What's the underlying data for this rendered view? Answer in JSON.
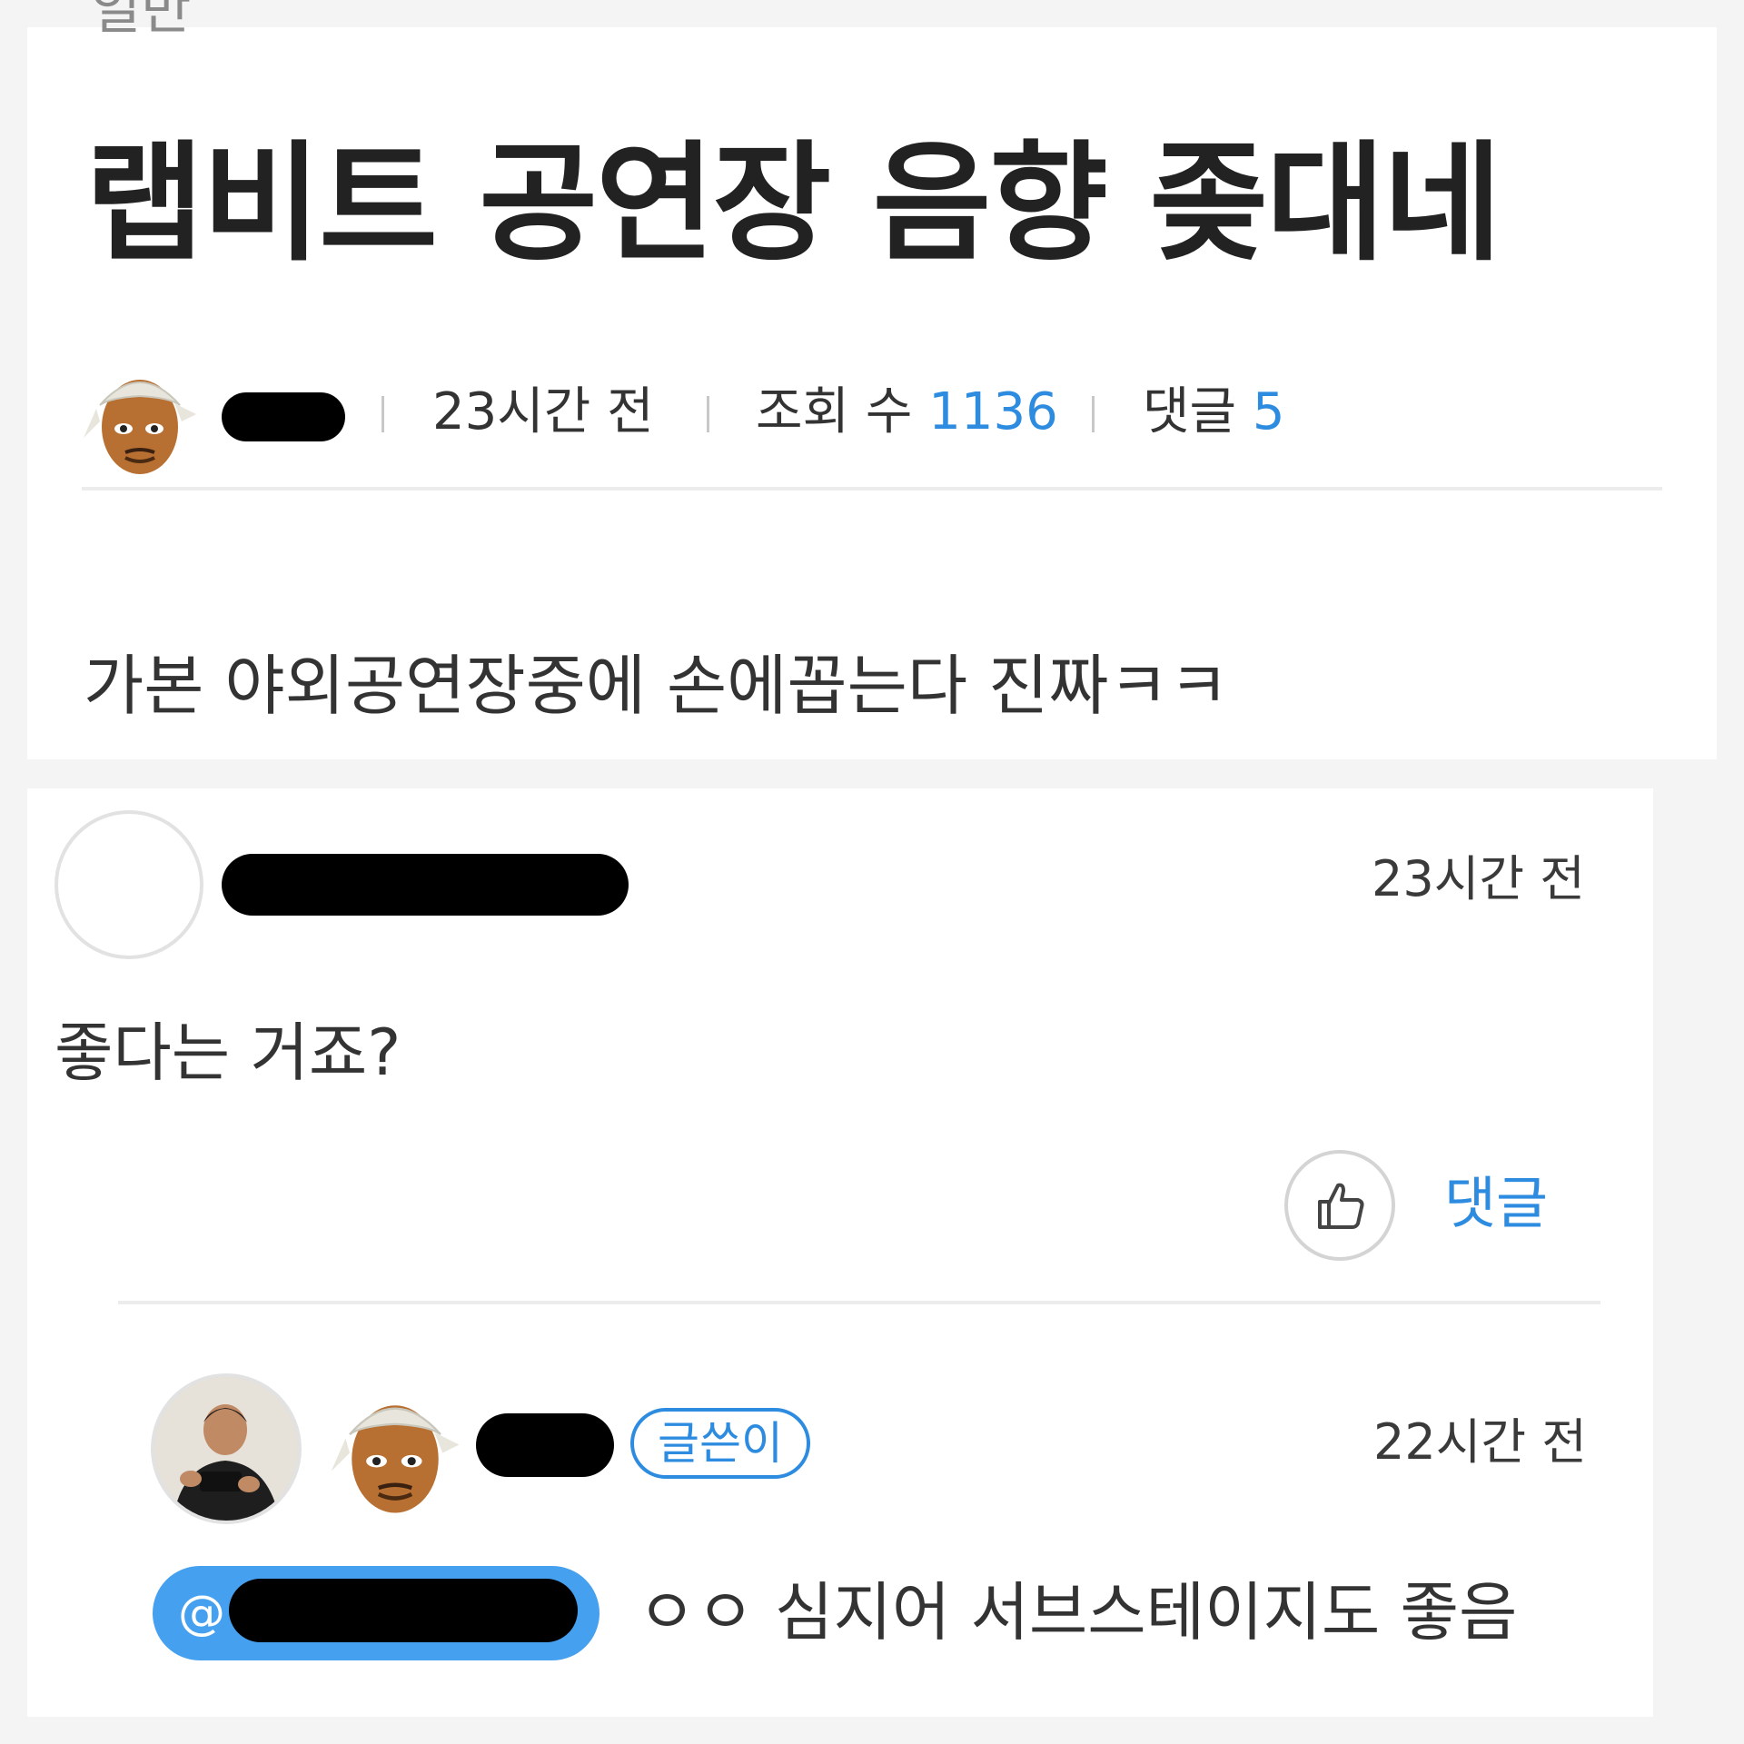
{
  "post": {
    "category": "일반",
    "title": "랩비트 공연장 음향 좆대네",
    "time_ago": "23시간 전",
    "views_label": "조회 수",
    "views_count": "1136",
    "comments_label": "댓글",
    "comments_count": "5",
    "body": "가본 야외공연장중에 손에꼽는다 진짜ㅋㅋ"
  },
  "comments": [
    {
      "time_ago": "23시간 전",
      "text": "좋다는 거죠?",
      "reply_label": "댓글"
    },
    {
      "author_badge": "글쓴이",
      "time_ago": "22시간 전",
      "mention_prefix": "@",
      "text": "ㅇㅇ 심지어 서브스테이지도 좋음"
    }
  ],
  "colors": {
    "accent": "#2d8ce0",
    "mention_bg": "#46a0f0",
    "redaction": "#000000"
  }
}
